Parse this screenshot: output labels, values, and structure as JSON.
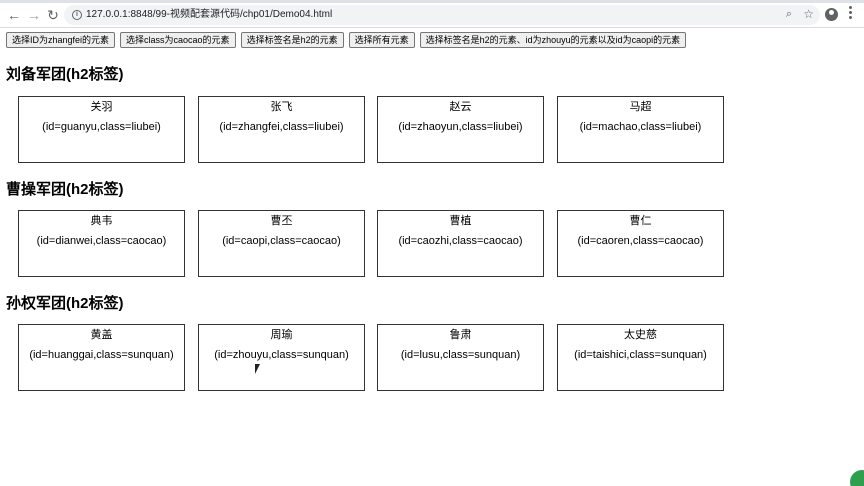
{
  "browser": {
    "url": "127.0.0.1:8848/99-视频配套源代码/chp01/Demo04.html",
    "back_icon": "back-arrow-icon",
    "forward_icon": "forward-arrow-icon",
    "reload_icon": "reload-icon"
  },
  "buttons": [
    "选择ID为zhangfei的元素",
    "选择class为caocao的元素",
    "选择标签名是h2的元素",
    "选择所有元素",
    "选择标签名是h2的元素、id为zhouyu的元素以及id为caopi的元素"
  ],
  "sections": [
    {
      "title": "刘备军团(h2标签)",
      "cards": [
        {
          "name": "关羽",
          "attr": "(id=guanyu,class=liubei)"
        },
        {
          "name": "张飞",
          "attr": "(id=zhangfei,class=liubei)"
        },
        {
          "name": "赵云",
          "attr": "(id=zhaoyun,class=liubei)"
        },
        {
          "name": "马超",
          "attr": "(id=machao,class=liubei)"
        }
      ]
    },
    {
      "title": "曹操军团(h2标签)",
      "cards": [
        {
          "name": "典韦",
          "attr": "(id=dianwei,class=caocao)"
        },
        {
          "name": "曹丕",
          "attr": "(id=caopi,class=caocao)"
        },
        {
          "name": "曹植",
          "attr": "(id=caozhi,class=caocao)"
        },
        {
          "name": "曹仁",
          "attr": "(id=caoren,class=caocao)"
        }
      ]
    },
    {
      "title": "孙权军团(h2标签)",
      "cards": [
        {
          "name": "黄盖",
          "attr": "(id=huanggai,class=sunquan)"
        },
        {
          "name": "周瑜",
          "attr": "(id=zhouyu,class=sunquan)"
        },
        {
          "name": "鲁肃",
          "attr": "(id=lusu,class=sunquan)"
        },
        {
          "name": "太史慈",
          "attr": "(id=taishici,class=sunquan)"
        }
      ]
    }
  ]
}
